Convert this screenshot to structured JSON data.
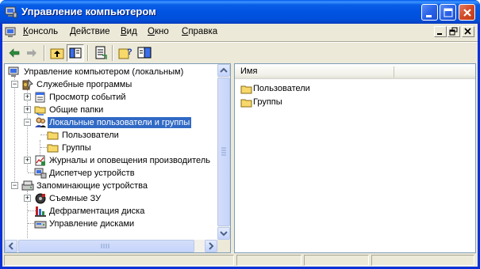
{
  "window": {
    "title": "Управление компьютером"
  },
  "menu": {
    "items": [
      {
        "label": "Консоль",
        "accel": "К"
      },
      {
        "label": "Действие",
        "accel": "Д"
      },
      {
        "label": "Вид",
        "accel": "В"
      },
      {
        "label": "Окно",
        "accel": "О"
      },
      {
        "label": "Справка",
        "accel": "С"
      }
    ]
  },
  "toolbar": {
    "buttons": [
      "back-icon",
      "forward-icon",
      "up-level-icon",
      "show-hide-tree-icon",
      "export-list-icon",
      "help-icon",
      "action-pane-icon"
    ]
  },
  "tree": {
    "items": [
      {
        "label": "Управление компьютером (локальным)",
        "icon": "computer-management-icon"
      },
      {
        "label": "Служебные программы",
        "icon": "system-tools-icon",
        "expander": "−"
      },
      {
        "label": "Просмотр событий",
        "icon": "event-viewer-icon",
        "expander": "+"
      },
      {
        "label": "Общие папки",
        "icon": "shared-folders-icon",
        "expander": "+"
      },
      {
        "label": "Локальные пользователи и группы",
        "icon": "users-groups-icon",
        "expander": "−",
        "selected": true
      },
      {
        "label": "Пользователи",
        "icon": "folder-icon"
      },
      {
        "label": "Группы",
        "icon": "folder-icon"
      },
      {
        "label": "Журналы и оповещения производитель",
        "icon": "performance-logs-icon",
        "expander": "+"
      },
      {
        "label": "Диспетчер устройств",
        "icon": "device-manager-icon"
      },
      {
        "label": "Запоминающие устройства",
        "icon": "storage-icon",
        "expander": "−"
      },
      {
        "label": "Съемные ЗУ",
        "icon": "removable-storage-icon",
        "expander": "+"
      },
      {
        "label": "Дефрагментация диска",
        "icon": "defrag-icon"
      },
      {
        "label": "Управление дисками",
        "icon": "disk-management-icon"
      }
    ]
  },
  "list": {
    "column": "Имя",
    "items": [
      {
        "label": "Пользователи",
        "icon": "folder-icon"
      },
      {
        "label": "Группы",
        "icon": "folder-icon"
      }
    ]
  },
  "colors": {
    "selection": "#316ac5",
    "titlebar": "#0053e1",
    "face": "#ece9d8"
  }
}
